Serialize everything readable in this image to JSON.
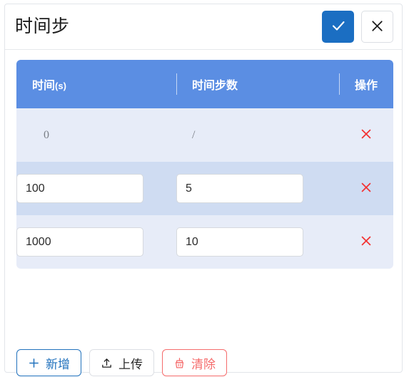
{
  "dialog": {
    "title": "时间步",
    "confirm_icon": "check-icon",
    "cancel_icon": "close-icon"
  },
  "table": {
    "columns": [
      {
        "label": "时间",
        "unit": "(s)",
        "key": "time"
      },
      {
        "label": "时间步数",
        "unit": "",
        "key": "steps"
      },
      {
        "label": "操作",
        "unit": "",
        "key": "action"
      }
    ],
    "rows": [
      {
        "time": "0",
        "steps": "/",
        "editable": false,
        "stripe": "light",
        "delete_icon": "close-icon"
      },
      {
        "time": "100",
        "steps": "5",
        "editable": true,
        "stripe": "dark",
        "delete_icon": "close-icon"
      },
      {
        "time": "1000",
        "steps": "10",
        "editable": true,
        "stripe": "light",
        "delete_icon": "close-icon"
      }
    ]
  },
  "footer": {
    "add_label": "新增",
    "add_icon": "plus-icon",
    "upload_label": "上传",
    "upload_icon": "upload-icon",
    "clear_label": "清除",
    "clear_icon": "broom-icon"
  },
  "colors": {
    "primary": "#1b6ec2",
    "table_header": "#5b8ee3",
    "row_light": "#e7ecf8",
    "row_dark": "#cfdcf2",
    "danger": "#f33232",
    "clear_red": "#f56c6c"
  }
}
